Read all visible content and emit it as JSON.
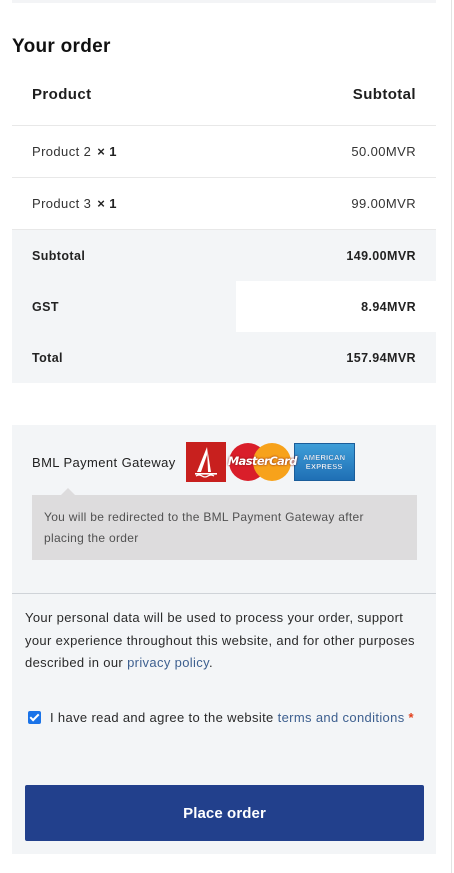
{
  "order": {
    "heading": "Your order",
    "columns": {
      "product": "Product",
      "subtotal": "Subtotal"
    },
    "items": [
      {
        "name": "Product 2",
        "qty": "× 1",
        "price": "50.00MVR"
      },
      {
        "name": "Product 3",
        "qty": "× 1",
        "price": "99.00MVR"
      }
    ],
    "totals": [
      {
        "label": "Subtotal",
        "value": "149.00MVR"
      },
      {
        "label": "GST",
        "value": "8.94MVR"
      },
      {
        "label": "Total",
        "value": "157.94MVR"
      }
    ]
  },
  "payment": {
    "gateway_label": "BML Payment Gateway",
    "card_icons": [
      "bml-logo-icon",
      "mastercard-logo-icon",
      "amex-logo-icon"
    ],
    "mastercard_text": "MasterCard",
    "amex_line1": "AMERICAN",
    "amex_line2": "EXPRESS",
    "redirect_note": "You will be redirected to the BML Payment Gateway after placing the order"
  },
  "privacy": {
    "text": "Your personal data will be used to process your order, support your experience throughout this website, and for other purposes described in our ",
    "link": "privacy policy",
    "suffix": "."
  },
  "terms": {
    "checked": true,
    "text": "I have read and agree to the website ",
    "link": "terms and conditions",
    "required_mark": "*"
  },
  "place_order_label": "Place order",
  "colors": {
    "button": "#22408c",
    "link": "#3d5f8f",
    "panel": "#f3f5f7",
    "required": "#e2401c",
    "checkbox": "#1a73e8"
  }
}
